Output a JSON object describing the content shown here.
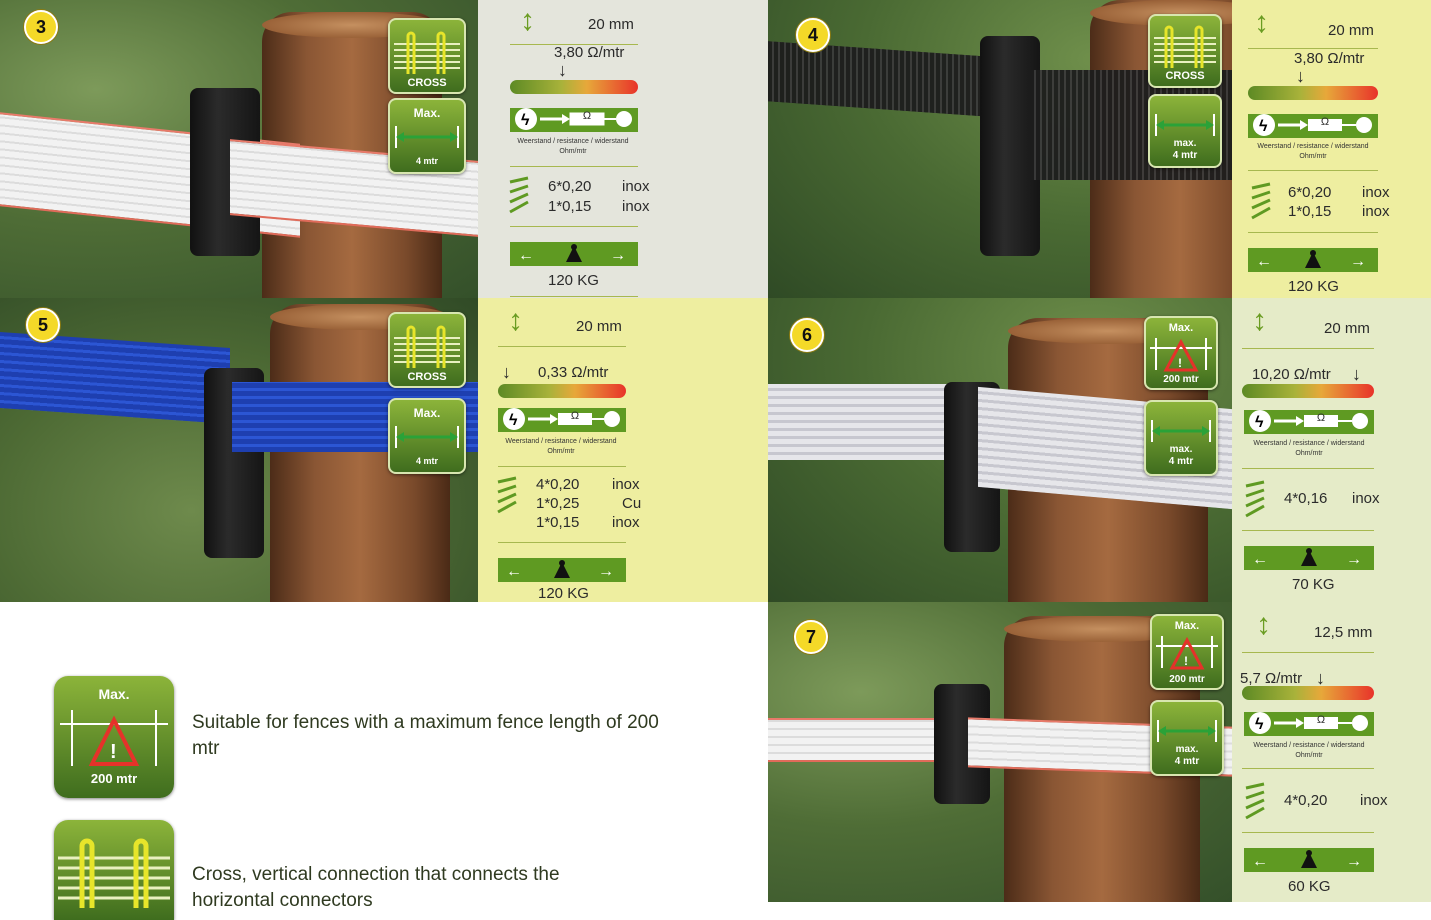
{
  "colors": {
    "accent_green": "#5f9a22",
    "badge_yellow": "#f4d928",
    "panel_gray": "#e4e5dc",
    "panel_yellow": "#eeeea0",
    "panel_lightgreen": "#e5ebc8"
  },
  "products": [
    {
      "number": "3",
      "height": "20 mm",
      "resistance": "3,80 Ω/mtr",
      "conductors": [
        [
          "6*0,20",
          "inox"
        ],
        [
          "1*0,15",
          "inox"
        ]
      ],
      "strength": "120 KG",
      "icons": [
        "cross-icon",
        "max-4-mtr-icon"
      ]
    },
    {
      "number": "4",
      "height": "20 mm",
      "resistance": "3,80 Ω/mtr",
      "conductors": [
        [
          "6*0,20",
          "inox"
        ],
        [
          "1*0,15",
          "inox"
        ]
      ],
      "strength": "120 KG",
      "icons": [
        "cross-icon",
        "max-4-mtr-icon"
      ]
    },
    {
      "number": "5",
      "height": "20 mm",
      "resistance": "0,33 Ω/mtr",
      "conductors": [
        [
          "4*0,20",
          "inox"
        ],
        [
          "1*0,25",
          "Cu"
        ],
        [
          "1*0,15",
          "inox"
        ]
      ],
      "strength": "120 KG",
      "icons": [
        "cross-icon",
        "max-4-mtr-icon"
      ]
    },
    {
      "number": "6",
      "height": "20 mm",
      "resistance": "10,20 Ω/mtr",
      "conductors": [
        [
          "4*0,16",
          "inox"
        ]
      ],
      "strength": "70 KG",
      "icons": [
        "max-200-mtr-icon",
        "max-4-mtr-icon"
      ]
    },
    {
      "number": "7",
      "height": "12,5 mm",
      "resistance": "5,7  Ω/mtr",
      "conductors": [
        [
          "4*0,20",
          "inox"
        ]
      ],
      "strength": "60 KG",
      "icons": [
        "max-200-mtr-icon",
        "max-4-mtr-icon"
      ]
    }
  ],
  "resistance_caption": "Weerstand / resistance / widerstand",
  "resistance_unit": "Ohm/mtr",
  "ohm_symbol": "Ω",
  "icon_labels": {
    "cross": "CROSS",
    "max": "Max.",
    "max_lower": "max.",
    "four_mtr": "4 mtr",
    "two_hundred_mtr": "200 mtr"
  },
  "legend": [
    {
      "icon": "max-200-mtr-icon",
      "text": "Suitable for fences with a maximum fence length of 200 mtr"
    },
    {
      "icon": "cross-icon",
      "text": "Cross, vertical connection that connects the horizontal connectors"
    }
  ]
}
